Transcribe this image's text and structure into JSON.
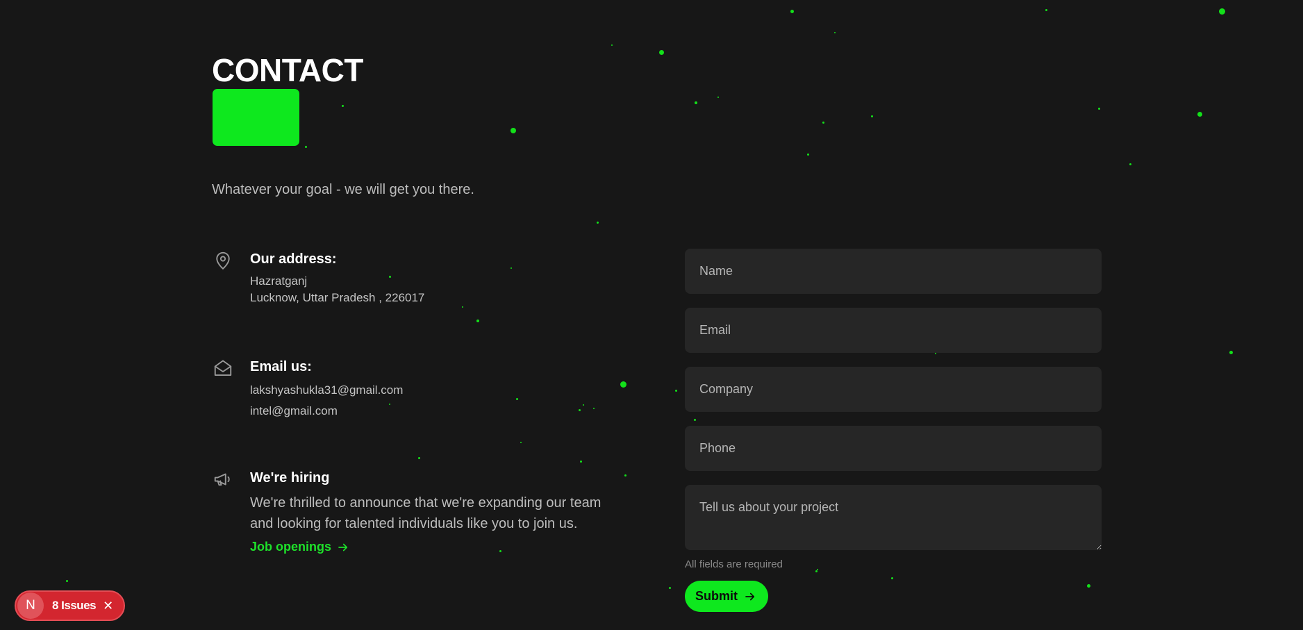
{
  "page": {
    "title": "CONTACT",
    "tagline": "Whatever your goal - we will get you there."
  },
  "contact_info": {
    "address": {
      "icon": "location-pin-icon",
      "heading": "Our address:",
      "lines": [
        "Hazratganj",
        "Lucknow, Uttar Pradesh , 226017"
      ]
    },
    "email": {
      "icon": "envelope-open-icon",
      "heading": "Email us:",
      "addresses": [
        "lakshyashukla31@gmail.com",
        "intel@gmail.com"
      ]
    },
    "hiring": {
      "icon": "megaphone-icon",
      "heading": "We're hiring",
      "description": "We're thrilled to announce that we're expanding our team and looking for talented individuals like you to join us.",
      "link_label": "Job openings",
      "link_icon": "arrow-right-icon"
    }
  },
  "form": {
    "name_placeholder": "Name",
    "email_placeholder": "Email",
    "company_placeholder": "Company",
    "phone_placeholder": "Phone",
    "message_placeholder": "Tell us about your project",
    "note": "All fields are required",
    "submit_label": "Submit",
    "submit_icon": "arrow-right-icon"
  },
  "dev_overlay": {
    "avatar_letter": "N",
    "issues_label": "8 Issues",
    "close_icon": "close-icon"
  },
  "colors": {
    "background": "#171717",
    "accent": "#0ee81e",
    "input_background": "#262626",
    "issues_badge": "#d3262f"
  }
}
